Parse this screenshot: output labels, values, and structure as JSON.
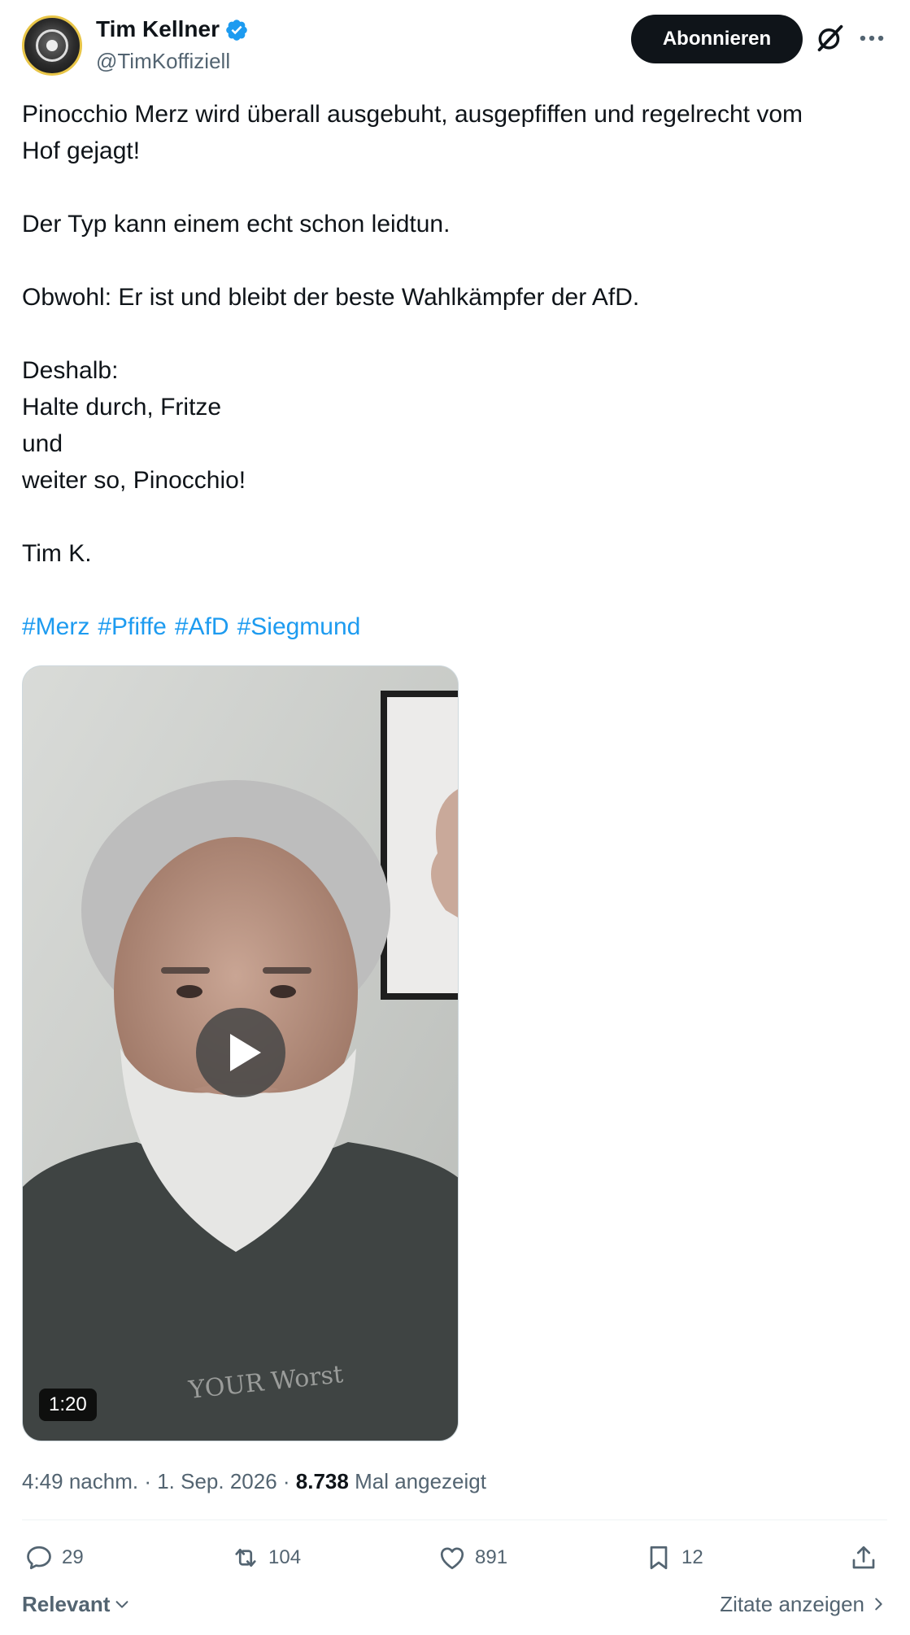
{
  "author": {
    "name": "Tim Kellner",
    "handle": "@TimKoffiziell",
    "verified": true
  },
  "header": {
    "subscribe_label": "Abonnieren",
    "icons": [
      "grok-icon",
      "more-icon"
    ]
  },
  "tweet": {
    "lines": [
      "Pinocchio Merz wird überall ausgebuht, ausgepfiffen und regelrecht vom",
      "Hof gejagt!",
      "",
      "Der Typ kann einem echt schon leidtun.",
      "",
      "Obwohl: Er ist und bleibt der beste Wahlkämpfer der AfD.",
      "",
      "Deshalb:",
      "Halte durch, Fritze",
      "und",
      "weiter so, Pinocchio!",
      "",
      "Tim K.",
      ""
    ],
    "hashtags": [
      "#Merz",
      "#Pfiffe",
      "#AfD",
      "#Siegmund"
    ]
  },
  "media": {
    "type": "video",
    "duration": "1:20",
    "shirt_text": "YOUR Worst"
  },
  "meta": {
    "time": "4:49 nachm.",
    "sep1": " · ",
    "date": "1. Sep. 2026",
    "sep2": " · ",
    "views": "8.738",
    "views_label": " Mal angezeigt"
  },
  "actions": {
    "replies": "29",
    "reposts": "104",
    "likes": "891",
    "bookmarks": "12"
  },
  "footer": {
    "sort_label": "Relevant",
    "quotes_label": "Zitate anzeigen"
  },
  "colors": {
    "accent": "#1d9bf0",
    "text": "#0f1419",
    "secondary": "#536471",
    "button": "#0f1419"
  }
}
